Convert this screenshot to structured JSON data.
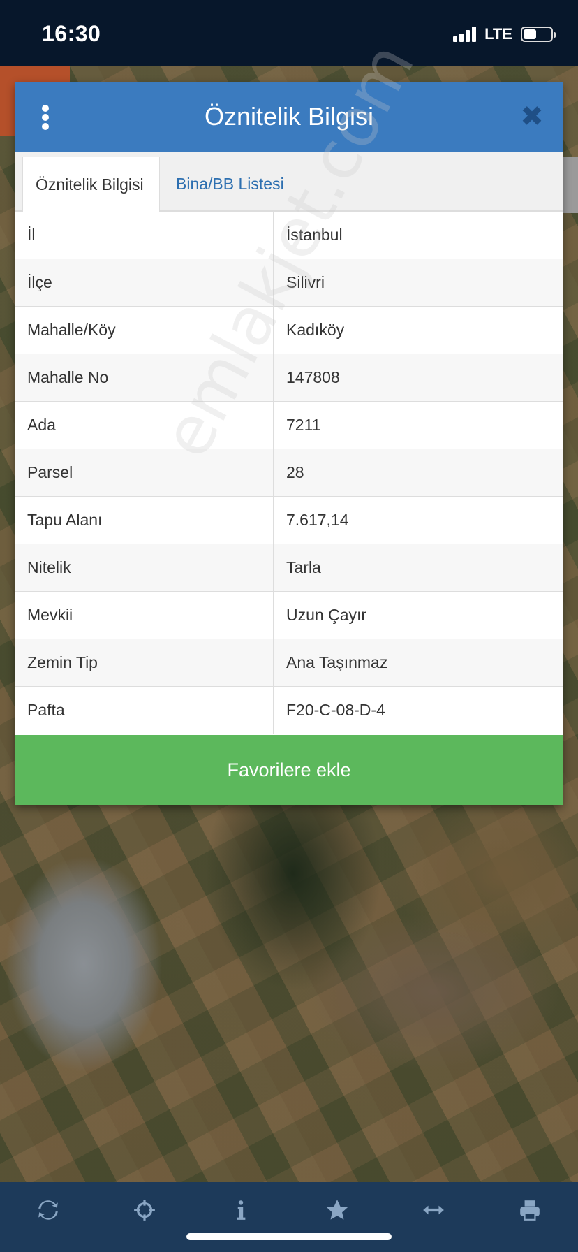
{
  "status_bar": {
    "time": "16:30",
    "network": "LTE",
    "battery_level": 0.45
  },
  "modal": {
    "title": "Öznitelik Bilgisi",
    "menu_icon": "vertical-dots-icon",
    "close_icon": "close-icon",
    "close_glyph": "✖",
    "tabs": [
      {
        "label": "Öznitelik Bilgisi",
        "active": true
      },
      {
        "label": "Bina/BB Listesi",
        "active": false
      }
    ],
    "rows": [
      {
        "key": "İl",
        "value": "İstanbul"
      },
      {
        "key": "İlçe",
        "value": "Silivri"
      },
      {
        "key": "Mahalle/Köy",
        "value": "Kadıköy"
      },
      {
        "key": "Mahalle No",
        "value": "147808"
      },
      {
        "key": "Ada",
        "value": "7211"
      },
      {
        "key": "Parsel",
        "value": "28"
      },
      {
        "key": "Tapu Alanı",
        "value": "7.617,14"
      },
      {
        "key": "Nitelik",
        "value": "Tarla"
      },
      {
        "key": "Mevkii",
        "value": "Uzun Çayır"
      },
      {
        "key": "Zemin Tip",
        "value": "Ana Taşınmaz"
      },
      {
        "key": "Pafta",
        "value": "F20-C-08-D-4"
      }
    ],
    "favorite_button": "Favorilere ekle",
    "accent_color": "#3b7bbf",
    "button_color": "#5cb85c"
  },
  "watermark": "emlakjet.com",
  "toolbar": {
    "icons": [
      "refresh-icon",
      "crosshair-icon",
      "info-icon",
      "star-icon",
      "measure-icon",
      "print-icon"
    ]
  }
}
